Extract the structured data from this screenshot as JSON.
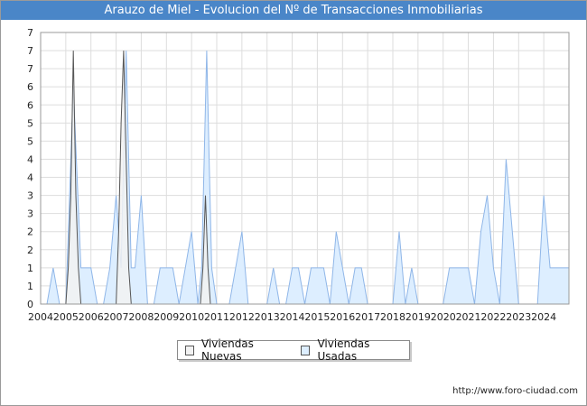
{
  "title": "Arauzo de Miel - Evolucion del Nº de Transacciones Inmobiliarias",
  "footer": "http://www.foro-ciudad.com",
  "colors": {
    "nuevas": "#f2f2f2",
    "usadas": "#ddeeff",
    "usadas_line": "#8fb6e8",
    "nuevas_line": "#555555",
    "title_bg": "#4a86c8"
  },
  "chart_data": {
    "type": "area",
    "title": "Arauzo de Miel - Evolucion del Nº de Transacciones Inmobiliarias",
    "xlim": [
      2004,
      2025
    ],
    "ylim": [
      0,
      7.5
    ],
    "grid": true,
    "legend_position": "bottom-center",
    "x_ticks": [
      "2004",
      "2005",
      "2006",
      "2007",
      "2008",
      "2009",
      "2010",
      "2011",
      "2012",
      "2013",
      "2014",
      "2015",
      "2016",
      "2017",
      "2018",
      "2019",
      "2020",
      "2021",
      "2022",
      "2023",
      "2024"
    ],
    "y_ticks": [
      {
        "value": 0,
        "label": "0"
      },
      {
        "value": 0.5,
        "label": "1"
      },
      {
        "value": 1,
        "label": "1"
      },
      {
        "value": 1.5,
        "label": "2"
      },
      {
        "value": 2,
        "label": "2"
      },
      {
        "value": 2.5,
        "label": "3"
      },
      {
        "value": 3,
        "label": "3"
      },
      {
        "value": 3.5,
        "label": "4"
      },
      {
        "value": 4,
        "label": "4"
      },
      {
        "value": 4.5,
        "label": "5"
      },
      {
        "value": 5,
        "label": "5"
      },
      {
        "value": 5.5,
        "label": "6"
      },
      {
        "value": 6,
        "label": "6"
      },
      {
        "value": 6.5,
        "label": "7"
      },
      {
        "value": 7,
        "label": "7"
      },
      {
        "value": 7.5,
        "label": "7"
      }
    ],
    "series": [
      {
        "name": "Viviendas Nuevas",
        "points": [
          [
            2004,
            0
          ],
          [
            2005,
            0
          ],
          [
            2005.1,
            1
          ],
          [
            2005.2,
            3
          ],
          [
            2005.3,
            7
          ],
          [
            2005.4,
            3
          ],
          [
            2005.5,
            1
          ],
          [
            2005.6,
            0
          ],
          [
            2007.0,
            0
          ],
          [
            2007.1,
            2
          ],
          [
            2007.2,
            5
          ],
          [
            2007.3,
            7
          ],
          [
            2007.4,
            4
          ],
          [
            2007.5,
            1
          ],
          [
            2007.6,
            0
          ],
          [
            2010.35,
            0
          ],
          [
            2010.45,
            1
          ],
          [
            2010.55,
            3
          ],
          [
            2010.65,
            1
          ],
          [
            2010.75,
            0
          ],
          [
            2025,
            0
          ]
        ]
      },
      {
        "name": "Viviendas Usadas",
        "points": [
          [
            2004,
            0
          ],
          [
            2004.25,
            0
          ],
          [
            2004.5,
            1
          ],
          [
            2004.75,
            0
          ],
          [
            2005,
            0
          ],
          [
            2005.3,
            6
          ],
          [
            2005.6,
            1
          ],
          [
            2006.0,
            1
          ],
          [
            2006.25,
            0
          ],
          [
            2006.5,
            0
          ],
          [
            2006.75,
            1
          ],
          [
            2007.0,
            3
          ],
          [
            2007.2,
            1
          ],
          [
            2007.4,
            7
          ],
          [
            2007.6,
            1
          ],
          [
            2007.75,
            1
          ],
          [
            2008.0,
            3
          ],
          [
            2008.25,
            0
          ],
          [
            2008.5,
            0
          ],
          [
            2008.75,
            1
          ],
          [
            2009.0,
            1
          ],
          [
            2009.25,
            1
          ],
          [
            2009.5,
            0
          ],
          [
            2009.75,
            1
          ],
          [
            2010.0,
            2
          ],
          [
            2010.25,
            0
          ],
          [
            2010.4,
            1
          ],
          [
            2010.5,
            4
          ],
          [
            2010.6,
            7
          ],
          [
            2010.7,
            4
          ],
          [
            2010.8,
            1
          ],
          [
            2011.0,
            0
          ],
          [
            2011.5,
            0
          ],
          [
            2011.75,
            1
          ],
          [
            2012.0,
            2
          ],
          [
            2012.25,
            0
          ],
          [
            2012.5,
            0
          ],
          [
            2013.0,
            0
          ],
          [
            2013.25,
            1
          ],
          [
            2013.5,
            0
          ],
          [
            2013.75,
            0
          ],
          [
            2014.0,
            1
          ],
          [
            2014.25,
            1
          ],
          [
            2014.5,
            0
          ],
          [
            2014.75,
            1
          ],
          [
            2015.0,
            1
          ],
          [
            2015.25,
            1
          ],
          [
            2015.5,
            0
          ],
          [
            2015.75,
            2
          ],
          [
            2016.0,
            1
          ],
          [
            2016.25,
            0
          ],
          [
            2016.5,
            1
          ],
          [
            2016.75,
            1
          ],
          [
            2017.0,
            0
          ],
          [
            2017.5,
            0
          ],
          [
            2018.0,
            0
          ],
          [
            2018.25,
            2
          ],
          [
            2018.5,
            0
          ],
          [
            2018.75,
            1
          ],
          [
            2019.0,
            0
          ],
          [
            2019.5,
            0
          ],
          [
            2020.0,
            0
          ],
          [
            2020.25,
            1
          ],
          [
            2020.5,
            1
          ],
          [
            2020.75,
            1
          ],
          [
            2021.0,
            1
          ],
          [
            2021.25,
            0
          ],
          [
            2021.5,
            2
          ],
          [
            2021.75,
            3
          ],
          [
            2022.0,
            1
          ],
          [
            2022.25,
            0
          ],
          [
            2022.5,
            4
          ],
          [
            2022.75,
            2
          ],
          [
            2023.0,
            0
          ],
          [
            2023.5,
            0
          ],
          [
            2023.75,
            0
          ],
          [
            2024.0,
            3
          ],
          [
            2024.25,
            1
          ],
          [
            2024.5,
            1
          ],
          [
            2025,
            1
          ]
        ]
      }
    ]
  }
}
